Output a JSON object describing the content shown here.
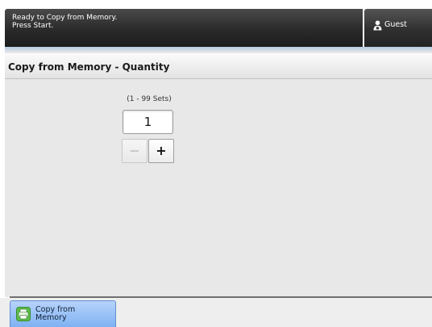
{
  "status": {
    "line1": "Ready to Copy from Memory.",
    "line2": "Press Start."
  },
  "user": {
    "label": "Guest",
    "icon": "user-icon"
  },
  "screen": {
    "title": "Copy from Memory - Quantity",
    "range_label": "(1 - 99 Sets)",
    "quantity_value": "1",
    "decrement_label": "−",
    "increment_label": "+"
  },
  "bottom_tab": {
    "label": "Copy from Memory",
    "icon": "printer-icon",
    "accent_color": "#8fbcf5"
  }
}
